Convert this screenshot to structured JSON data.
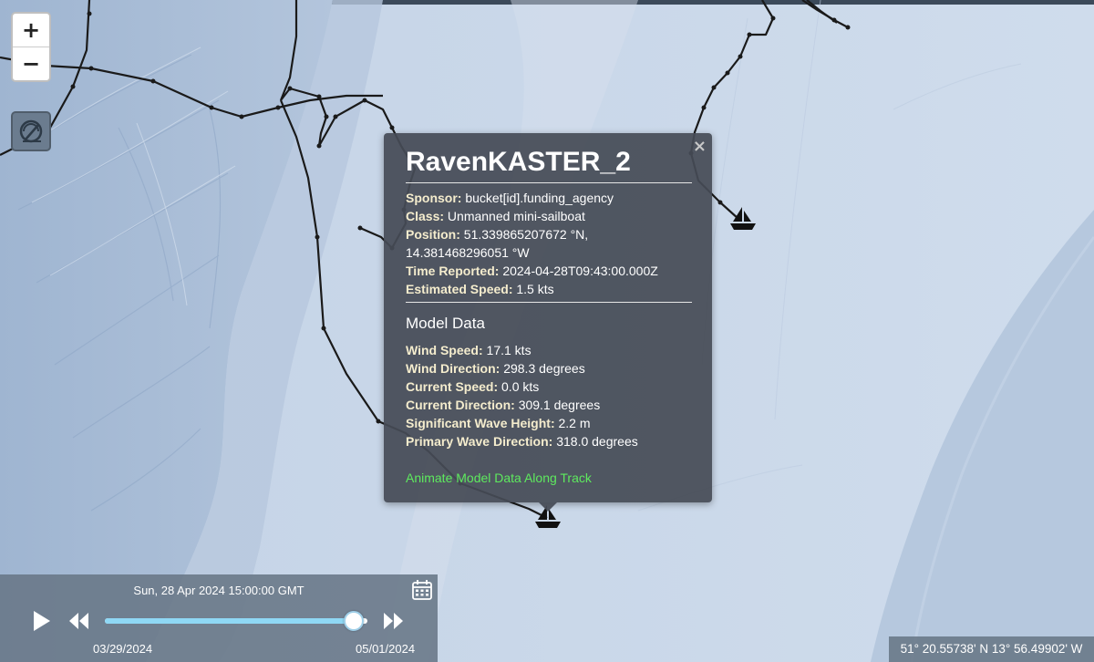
{
  "map": {
    "zoom_in_label": "+",
    "zoom_out_label": "−",
    "layer_icon": "compass-layer-icon",
    "water_color": "#c6d6e8",
    "shelf_color": "#9eb4d0",
    "track_color": "#1a1a1a"
  },
  "popup": {
    "title": "RavenKASTER_2",
    "close_label": "×",
    "info": [
      {
        "label": "Sponsor:",
        "value": "bucket[id].funding_agency"
      },
      {
        "label": "Class:",
        "value": "Unmanned mini-sailboat"
      },
      {
        "label": "Position:",
        "value": "51.339865207672 °N, 14.381468296051 °W"
      },
      {
        "label": "Time Reported:",
        "value": "2024-04-28T09:43:00.000Z"
      },
      {
        "label": "Estimated Speed:",
        "value": "1.5 kts"
      }
    ],
    "model_title": "Model Data",
    "model": [
      {
        "label": "Wind Speed:",
        "value": "17.1 kts"
      },
      {
        "label": "Wind Direction:",
        "value": "298.3 degrees"
      },
      {
        "label": "Current Speed:",
        "value": "0.0 kts"
      },
      {
        "label": "Current Direction:",
        "value": "309.1 degrees"
      },
      {
        "label": "Significant Wave Height:",
        "value": "2.2 m"
      },
      {
        "label": "Primary Wave Direction:",
        "value": "318.0 degrees"
      }
    ],
    "animate_link": "Animate Model Data Along Track"
  },
  "time": {
    "current": "Sun, 28 Apr 2024 15:00:00 GMT",
    "start": "03/29/2024",
    "end": "05/01/2024",
    "progress": 0.94,
    "accent": "#8fd8f5"
  },
  "coords": {
    "text": "51° 20.55738' N 13° 56.49902' W"
  }
}
